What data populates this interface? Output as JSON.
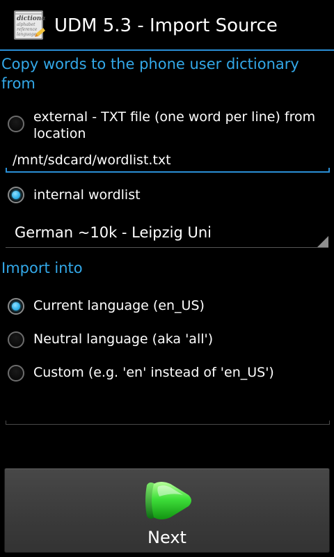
{
  "app": {
    "title": "UDM 5.3 - Import Source",
    "icon": "dictionary-book-icon"
  },
  "source_section": {
    "header": "Copy words to the phone user dictionary from",
    "external_option": {
      "label": "external - TXT file (one word per line) from location",
      "checked": false
    },
    "file_path": {
      "value": "/mnt/sdcard/wordlist.txt"
    },
    "internal_option": {
      "label": "internal wordlist",
      "checked": true
    },
    "wordlist_selector": {
      "selected": "German ~10k - Leipzig Uni"
    }
  },
  "target_section": {
    "header": "Import into",
    "options": [
      {
        "label": "Current language (en_US)",
        "checked": true
      },
      {
        "label": "Neutral language (aka 'all')",
        "checked": false
      },
      {
        "label": "Custom (e.g. 'en' instead of 'en_US')",
        "checked": false
      }
    ],
    "custom_value": ""
  },
  "footer": {
    "next_label": "Next",
    "next_icon": "green-play-arrow-icon"
  },
  "colors": {
    "accent": "#33a8e8",
    "background": "#000000",
    "button": "#404040",
    "radio_selected": "#33b5e5"
  }
}
